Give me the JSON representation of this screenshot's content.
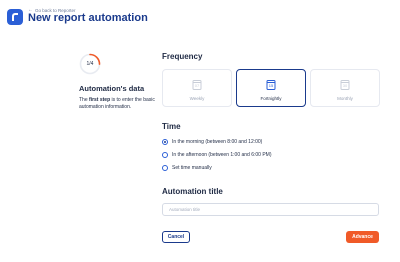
{
  "header": {
    "back_label": "Go back to Reporter",
    "title": "New report automation"
  },
  "side": {
    "step_counter": "1/4",
    "step_progress": 0.25,
    "title": "Automation's data",
    "text_bold": "first step",
    "text_prefix": "The ",
    "text_suffix": " is to enter the basic automation information."
  },
  "frequency": {
    "title": "Frequency",
    "options": [
      {
        "label": "Weekly",
        "icon_day": "07"
      },
      {
        "label": "Fortnightly",
        "icon_day": "15"
      },
      {
        "label": "Monthly",
        "icon_day": "30"
      }
    ],
    "selected": "Fortnightly"
  },
  "time": {
    "title": "Time",
    "options": [
      {
        "label": "In the morning (between 8:00 and 12:00)"
      },
      {
        "label": "In the afternoon (between 1:00 and 6:00 PM)"
      },
      {
        "label": "Set time manually"
      }
    ],
    "selected": "In the morning (between 8:00 and 12:00)"
  },
  "automation_title": {
    "title": "Automation title",
    "placeholder": "Automation title",
    "value": ""
  },
  "actions": {
    "cancel_label": "Cancel",
    "advance_label": "Advance"
  },
  "colors": {
    "primary": "#1a3a8c",
    "accent": "#f05a28",
    "logo": "#2b5fd6"
  }
}
